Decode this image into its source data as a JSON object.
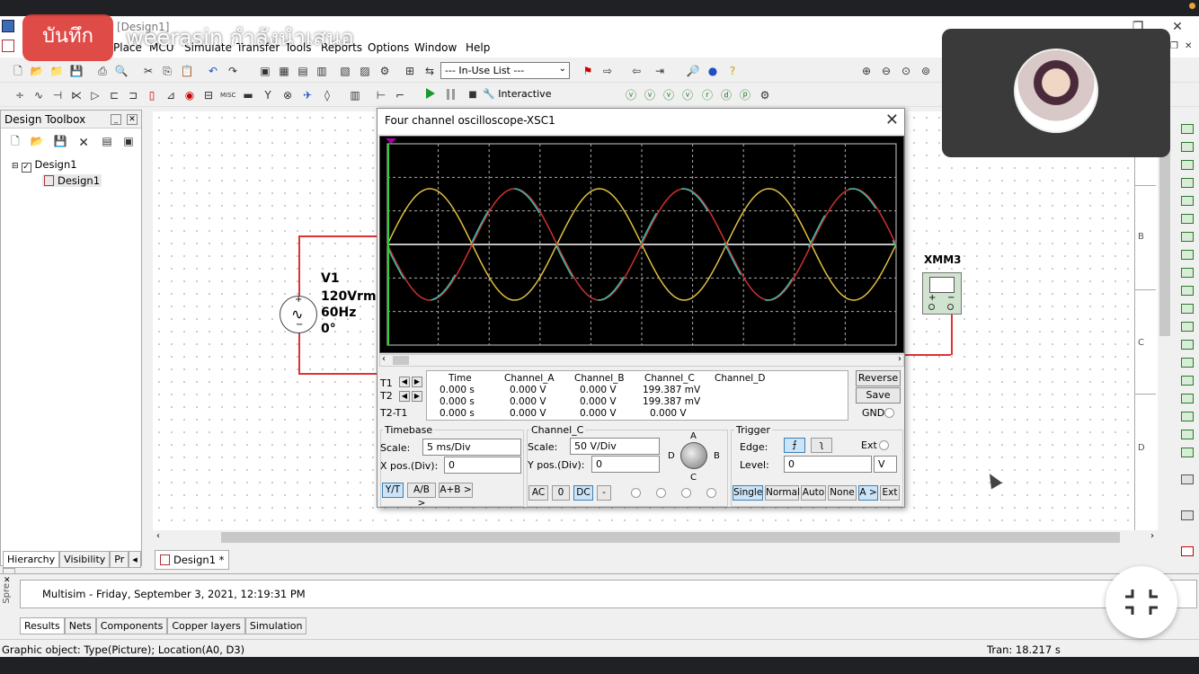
{
  "overlay": {
    "record_label": "บันทึก",
    "presenter_text": "weerasin กำลังนำเสนอ"
  },
  "window": {
    "title": "[Design1]"
  },
  "menu": [
    "Place",
    "MCU",
    "Simulate",
    "Transfer",
    "Tools",
    "Reports",
    "Options",
    "Window",
    "Help"
  ],
  "toolbar": {
    "in_use_list": "--- In-Use List ---",
    "interactive_label": "Interactive"
  },
  "toolbox": {
    "title": "Design Toolbox",
    "tree_root": "Design1",
    "tree_child": "Design1",
    "tabs": [
      "Hierarchy",
      "Visibility",
      "Pr"
    ]
  },
  "circuit": {
    "source_name": "V1",
    "source_voltage": "120Vrms",
    "source_freq": "60Hz",
    "source_phase": "0°",
    "meter_name": "XMM3"
  },
  "ruler": [
    "B",
    "C",
    "D"
  ],
  "design_tab": "Design1 *",
  "oscilloscope": {
    "title": "Four channel oscilloscope-XSC1",
    "headers": [
      "Time",
      "Channel_A",
      "Channel_B",
      "Channel_C",
      "Channel_D"
    ],
    "rows": [
      {
        "label": "T1",
        "time": "0.000 s",
        "a": "0.000 V",
        "b": "0.000 V",
        "c": "199.387 mV",
        "d": ""
      },
      {
        "label": "T2",
        "time": "0.000 s",
        "a": "0.000 V",
        "b": "0.000 V",
        "c": "199.387 mV",
        "d": ""
      },
      {
        "label": "T2-T1",
        "time": "0.000 s",
        "a": "0.000 V",
        "b": "0.000 V",
        "c": "0.000 V",
        "d": ""
      }
    ],
    "reverse_btn": "Reverse",
    "save_btn": "Save",
    "gnd_label": "GND",
    "timebase": {
      "title": "Timebase",
      "scale_label": "Scale:",
      "scale_value": "5 ms/Div",
      "xpos_label": "X pos.(Div):",
      "xpos_value": "0",
      "modes": [
        "Y/T",
        "A/B >",
        "A+B >"
      ]
    },
    "channel": {
      "title": "Channel_C",
      "scale_label": "Scale:",
      "scale_value": "50  V/Div",
      "ypos_label": "Y pos.(Div):",
      "ypos_value": "0",
      "coupling": [
        "AC",
        "0",
        "DC",
        "-"
      ],
      "knob_labels": [
        "A",
        "B",
        "C",
        "D"
      ]
    },
    "trigger": {
      "title": "Trigger",
      "edge_label": "Edge:",
      "ext_label": "Ext",
      "level_label": "Level:",
      "level_value": "0",
      "level_unit": "V",
      "modes": [
        "Single",
        "Normal",
        "Auto",
        "None",
        "A >",
        "Ext"
      ]
    }
  },
  "spreadsheet": {
    "message": "Multisim  -  Friday, September 3, 2021, 12:19:31 PM",
    "tabs": [
      "Results",
      "Nets",
      "Components",
      "Copper layers",
      "Simulation"
    ],
    "side_label": "Spre"
  },
  "status": {
    "left": "Graphic object: Type(Picture); Location(A0, D3)",
    "right": "Tran: 18.217 s"
  },
  "colors": {
    "trace_a": "#e0c040",
    "trace_b": "#d03030",
    "trace_c": "#30c0b0",
    "trace_axis": "#ffffff"
  }
}
